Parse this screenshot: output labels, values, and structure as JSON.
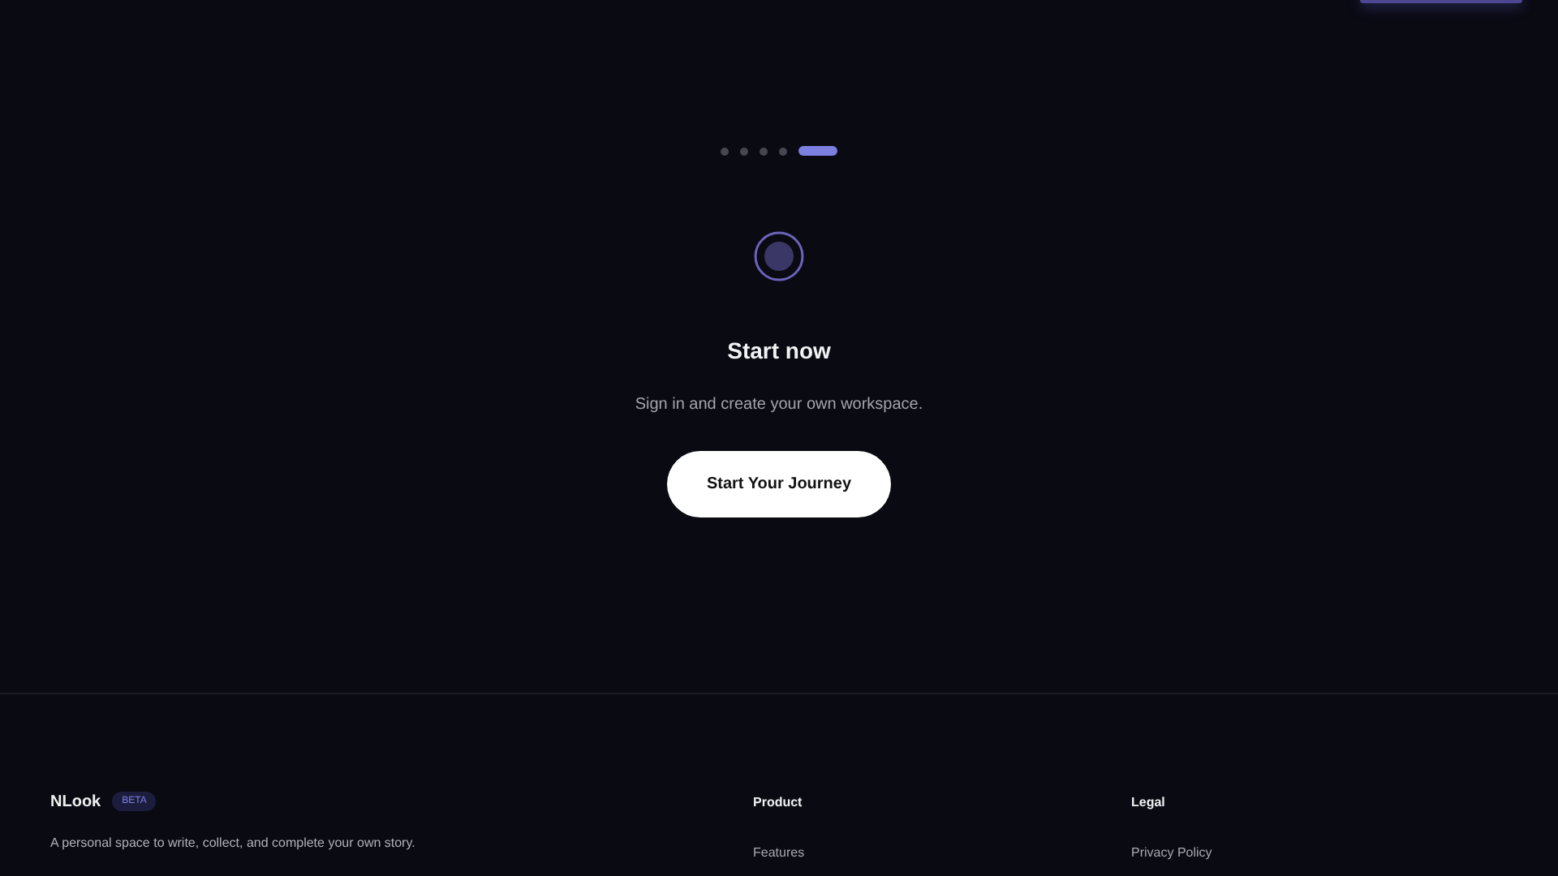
{
  "steps": [
    {
      "selected": false
    },
    {
      "selected": false
    },
    {
      "selected": false
    },
    {
      "selected": false
    },
    {
      "selected": true
    }
  ],
  "hero": {
    "title": "Start now",
    "subtitle": "Sign in and create your own workspace.",
    "button": "Start Your Journey"
  },
  "footer": {
    "brand": "NLook",
    "badge": "BETA",
    "tagline": "A personal space to write, collect, and complete your own story.",
    "columns": [
      {
        "heading": "Product",
        "links": [
          "Features"
        ]
      },
      {
        "heading": "Legal",
        "links": [
          "Privacy Policy"
        ]
      }
    ]
  }
}
